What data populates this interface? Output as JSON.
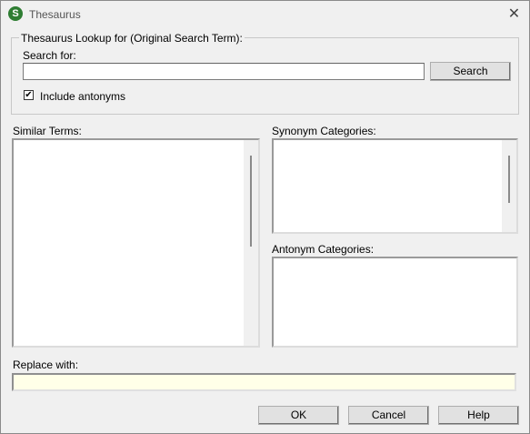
{
  "window": {
    "title": "Thesaurus",
    "app_icon_text": "S",
    "close_glyph": "✕"
  },
  "lookup": {
    "legend": "Thesaurus Lookup for (Original Search Term):",
    "search_label": "Search for:",
    "search_value": "",
    "search_button": "Search",
    "include_antonyms_label": "Include antonyms",
    "include_antonyms_checked": true,
    "check_glyph": "✔"
  },
  "similar_terms": {
    "label": "Similar Terms:",
    "items": []
  },
  "synonym_categories": {
    "label": "Synonym Categories:",
    "items": []
  },
  "antonym_categories": {
    "label": "Antonym Categories:",
    "items": []
  },
  "replace": {
    "label": "Replace with:",
    "value": ""
  },
  "buttons": {
    "ok": "OK",
    "cancel": "Cancel",
    "help": "Help"
  },
  "colors": {
    "replace_bg": "#ffffe8",
    "app_icon": "#2e7d32"
  }
}
